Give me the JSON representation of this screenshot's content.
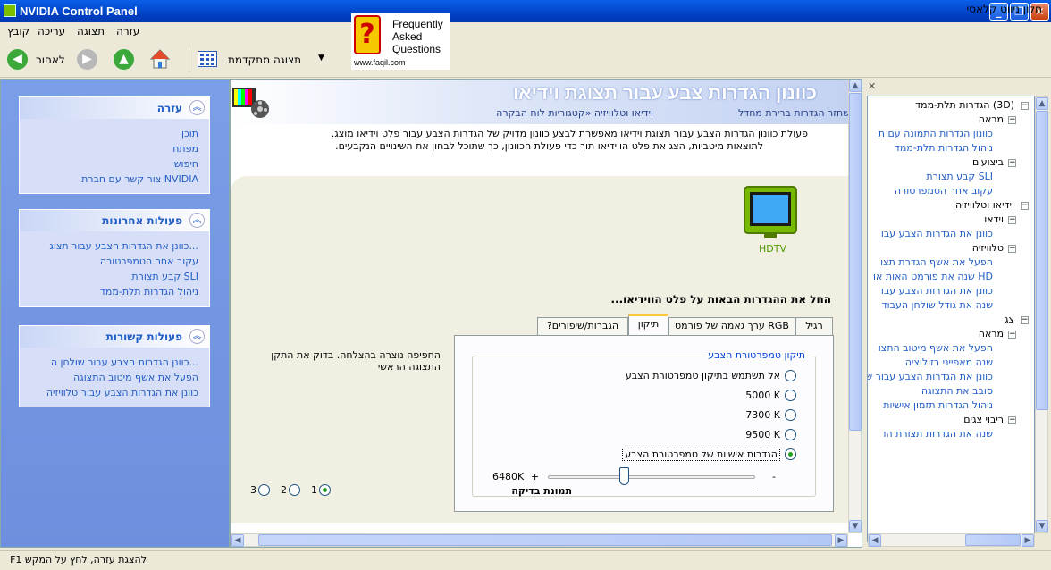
{
  "window": {
    "title": "NVIDIA Control Panel"
  },
  "menu": [
    "קובץ",
    "עריכה",
    "תצוגה",
    "עזרה"
  ],
  "toolbar": {
    "back_label": "לאחור",
    "advanced_label": "תצוגה מתקדמת"
  },
  "faq": {
    "line1": "Frequently",
    "line2": "Asked",
    "line3": "Questions",
    "url": "www.faqil.com"
  },
  "left": {
    "help": {
      "title": "עזרה",
      "links": [
        "תוכן",
        "מפתח",
        "חיפוש",
        "צור קשר עם חברת NVIDIA"
      ]
    },
    "recent": {
      "title": "פעולות אחרונות",
      "links": [
        "כוונן את הגדרות הצבע עבור תצוג...",
        "עקוב אחר הטמפרטורה",
        "קבע תצורת SLI",
        "ניהול הגדרות תלת-ממד"
      ]
    },
    "related": {
      "title": "פעולות קשורות",
      "links": [
        "כוונן הגדרות הצבע עבור שולחן ה...",
        "הפעל את אשף מיטוב התצוגה",
        "כוונן את הגדרות הצבע עבור טלוויזיה"
      ]
    }
  },
  "page": {
    "title": "כוונון הגדרות צבע עבור תצוגת וידיאו",
    "breadcrumb": "וידיאו וטלוויזיה   «קטגוריות לוח הבקרה",
    "restore": "שחזר הגדרות ברירת מחדל",
    "desc1": ".פעולת כוונון הגדרות הצבע עבור תצוגת וידיאו מאפשרת לבצע כוונון מדויק של הגדרות הצבע עבור פלט וידיאו מוצג",
    "desc2": ".לתוצאות מיטביות, הצג את פלט הווידיאו תוך כדי פעולת הכוונון, כך שתוכל לבחון את השינויים הנקבעים",
    "device_label": "HDTV",
    "section": "...החל את ההגדרות הבאות על פלט הווידיאו",
    "tabs": [
      "רגיל",
      "ערך גאמה של פורמט RGB",
      "תיקון",
      "?הגברות/שיפורים"
    ],
    "group_label": "תיקון טמפרטורת הצבע",
    "options": [
      "אל תשתמש בתיקון טמפרטורת הצבע",
      "5000 K",
      "7300 K",
      "9500 K",
      "הגדרות אישיות של טמפרטורת הצבע"
    ],
    "slider_value": "6480K",
    "slider_fraction": 0.37,
    "plus": "+",
    "minus": "-",
    "status_msg": "החפיפה נוצרה בהצלחה. בדוק את התקן התצוגה הראשי",
    "test_label": "תמונת בדיקה",
    "test_options": [
      "1",
      "2",
      "3"
    ]
  },
  "nav": {
    "title": "חלון ניווט קלאסי",
    "tree": [
      "הגדרות תלת-ממד (3D)",
      "מראה",
      "כוונון הגדרות התמונה עם ת",
      "ניהול הגדרות תלת-ממד",
      "ביצועים",
      "קבע תצורת SLI",
      "עקוב אחר הטמפרטורה",
      "וידיאו וטלוויזיה",
      "וידאו",
      "כוונן את הגדרות הצבע עבו",
      "טלוויזיה",
      "הפעל את אשף הגדרת תצו",
      "שנה את פורמט האות או HD",
      "כוונן את הגדרות הצבע עבו",
      "שנה את גודל שולחן העבוד",
      "צג",
      "מראה",
      "הפעל את אשף מיטוב התצו",
      "שנה מאפייני רזולוציה",
      "כוונן את הגדרות הצבע עבור ש",
      "סובב את התצוגה",
      "ניהול הגדרות תזמון אישיות",
      "ריבוי צגים",
      "שנה את הגדרות תצורת הו"
    ]
  },
  "status": {
    "text": "F1 להצגת עזרה, לחץ על המקש"
  },
  "colors": {
    "accent": "#215dc6",
    "nvidia_green": "#76b900",
    "titlebar": "#0a5fe8"
  }
}
